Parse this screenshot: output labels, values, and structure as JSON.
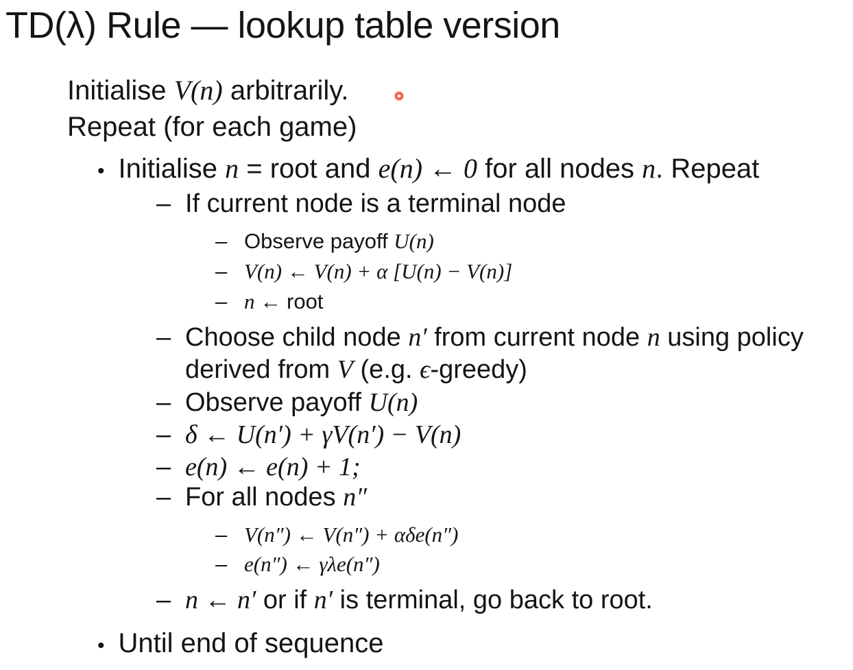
{
  "title": "TD(λ) Rule — lookup table version",
  "lines": {
    "init_pre": "Initialise ",
    "init_math": "V(n)",
    "init_post": " arbitrarily.",
    "repeat": "Repeat (for each game)",
    "b1_pre": "Initialise ",
    "b1_m1": "n",
    "b1_t1": " = root and ",
    "b1_m2": "e(n) ← 0",
    "b1_t2": " for all nodes ",
    "b1_m3": "n",
    "b1_t3": ". Repeat",
    "d1": "If current node is a terminal node",
    "s1_t": "Observe payoff ",
    "s1_m": "U(n)",
    "s2_m": "V(n) ← V(n) + α [U(n) − V(n)]",
    "s3_m": "n ← ",
    "s3_t": " root",
    "d2_t1": "Choose child node ",
    "d2_m1": "n′",
    "d2_t2": " from current node ",
    "d2_m2": "n",
    "d2_t3": " using policy",
    "d2b_t1": "derived from ",
    "d2b_m1": "V",
    "d2b_t2": " (e.g. ",
    "d2b_m2": "ϵ",
    "d2b_t3": "-greedy)",
    "d3_t": "Observe payoff ",
    "d3_m": "U(n)",
    "d4_m": "δ ← U(n′) + γV(n′) − V(n)",
    "d5_m": "e(n) ← e(n) + 1;",
    "d6_t": "For all nodes ",
    "d6_m": "n″",
    "s4_m": "V(n″) ← V(n″) + αδe(n″)",
    "s5_m": "e(n″) ← γλe(n″)",
    "d7_m1": "n ← n′",
    "d7_t1": " or if ",
    "d7_m2": "n′",
    "d7_t2": " is terminal, go back to root.",
    "b2": "Until end of sequence"
  },
  "symbols": {
    "bullet": "•",
    "dash": "–"
  }
}
